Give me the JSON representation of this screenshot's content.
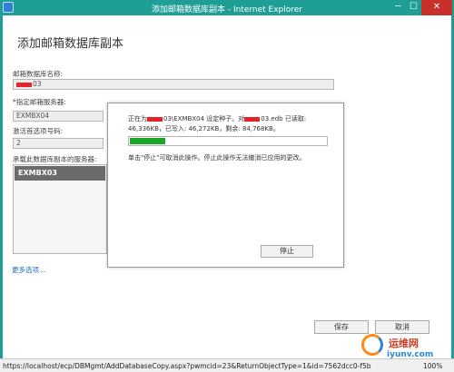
{
  "window": {
    "title": "添加邮箱数据库副本 - Internet Explorer",
    "minimize": "─",
    "maximize": "☐",
    "close": "✕"
  },
  "page": {
    "title": "添加邮箱数据库副本"
  },
  "form": {
    "db_name_label": "邮箱数据库名称:",
    "db_name_value": "03",
    "server_label": "*指定邮箱服务器:",
    "server_value": "EXMBX04",
    "pref_label": "激活首选项号码:",
    "pref_value": "2",
    "list_label": "承载此数据库副本的服务器:",
    "list_items": [
      "EXMBX03"
    ],
    "more_options": "更多选项...",
    "save": "保存",
    "cancel": "取消"
  },
  "progress": {
    "line1_before": "正在为",
    "line1_mid": "03\\EXMBX04 设定种子。对",
    "line1_after": "03.edb 已读取:",
    "line2": "46,336KB，已写入: 46,272KB，剩余: 84,768KB。",
    "percent": 18,
    "note": "单击\"停止\"可取消此操作。停止此操作无法撤消已应用的更改。",
    "stop": "停止"
  },
  "statusbar": {
    "url": "https://localhost/ecp/DBMgmt/AddDatabaseCopy.aspx?pwmcid=23&ReturnObjectType=1&id=7562dcc0-f5b",
    "zoom": "100%"
  },
  "watermark": {
    "cn": "运维网",
    "en": "iyunv.com"
  },
  "colors": {
    "titlebar": "#1f9e95",
    "progress": "#18a627",
    "close_button": "#c7302b",
    "redaction": "#e5242a"
  }
}
